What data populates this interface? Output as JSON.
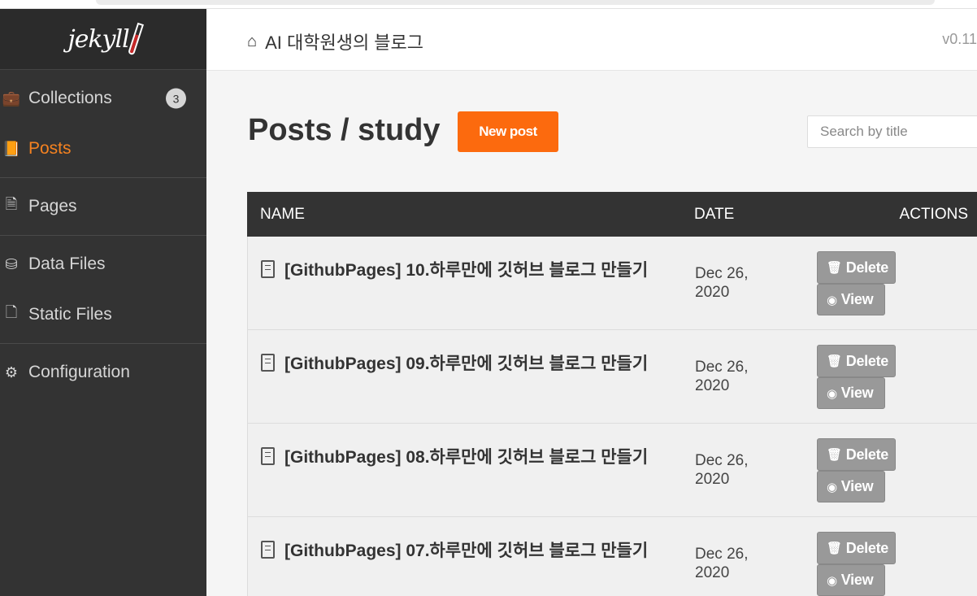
{
  "sidebar": {
    "logo_text": "jekyll",
    "items": [
      {
        "label": "Collections",
        "icon": "briefcase-icon",
        "badge": "3"
      },
      {
        "label": "Posts",
        "icon": "book-icon",
        "active": true
      },
      {
        "label": "Pages",
        "icon": "file-text-icon"
      },
      {
        "label": "Data Files",
        "icon": "database-icon"
      },
      {
        "label": "Static Files",
        "icon": "file-icon"
      },
      {
        "label": "Configuration",
        "icon": "gear-icon"
      }
    ]
  },
  "header": {
    "site_title": "AI 대학원생의 블로그",
    "version": "v0.11"
  },
  "main": {
    "page_title": "Posts / study",
    "new_post_label": "New post",
    "search_placeholder": "Search by title",
    "columns": [
      "NAME",
      "DATE",
      "ACTIONS"
    ],
    "delete_label": "Delete",
    "view_label": "View",
    "rows": [
      {
        "title": "[GithubPages] 10.하루만에 깃허브 블로그 만들기",
        "date": "Dec 26, 2020"
      },
      {
        "title": "[GithubPages] 09.하루만에 깃허브 블로그 만들기",
        "date": "Dec 26, 2020"
      },
      {
        "title": "[GithubPages] 08.하루만에 깃허브 블로그 만들기",
        "date": "Dec 26, 2020"
      },
      {
        "title": "[GithubPages] 07.하루만에 깃허브 블로그 만들기",
        "date": "Dec 26, 2020"
      }
    ]
  },
  "colors": {
    "accent": "#f58220",
    "button_primary": "#fc6a0e",
    "sidebar_bg": "#333333",
    "action_button": "#999999"
  }
}
